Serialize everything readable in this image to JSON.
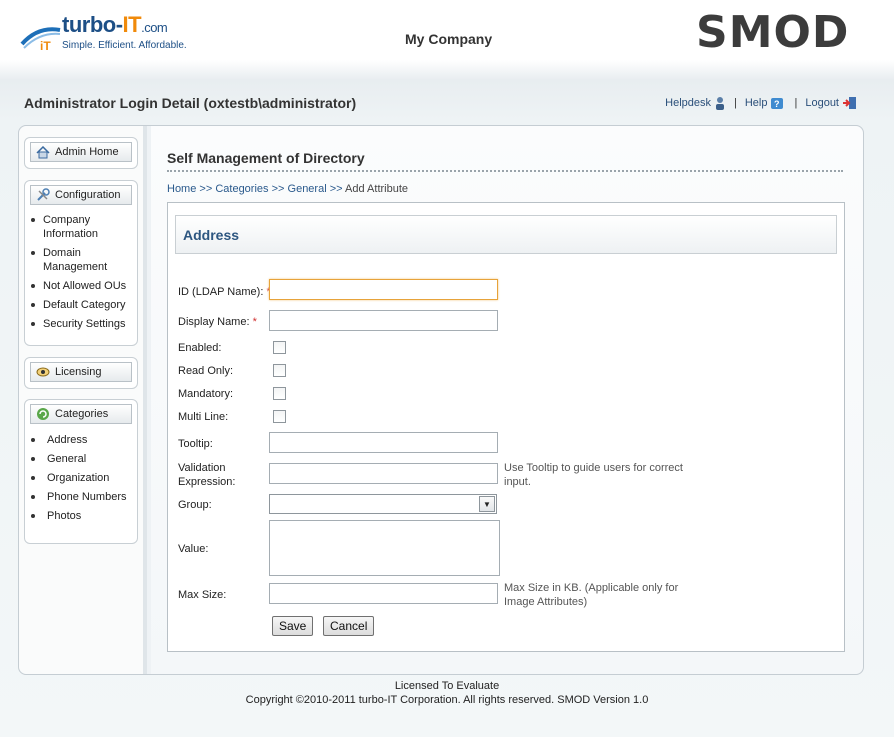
{
  "header": {
    "logo": {
      "name": "turbo-",
      "accent": "IT",
      "suffix": ".com",
      "tagline": "Simple. Efficient. Affordable.",
      "mark": "iT"
    },
    "company": "My Company",
    "brand": "SMOD"
  },
  "titlebar": {
    "title": "Administrator Login Detail (oxtestb\\administrator)",
    "links": {
      "helpdesk": "Helpdesk",
      "help": "Help",
      "logout": "Logout"
    }
  },
  "sidebar": {
    "admin_home": "Admin Home",
    "configuration": {
      "label": "Configuration",
      "items": [
        "Company Information",
        "Domain Management",
        "Not Allowed OUs",
        "Default Category",
        "Security Settings"
      ]
    },
    "licensing": "Licensing",
    "categories": {
      "label": "Categories",
      "items": [
        "Address",
        "General",
        "Organization",
        "Phone Numbers",
        "Photos"
      ]
    }
  },
  "main": {
    "section_title": "Self Management of Directory",
    "breadcrumb": {
      "home": "Home",
      "categories": "Categories",
      "general": "General",
      "current": "Add Attribute",
      "sep": ">>"
    },
    "form": {
      "heading": "Address",
      "fields": {
        "id": {
          "label": "ID (LDAP Name):",
          "value": ""
        },
        "display_name": {
          "label": "Display Name:",
          "value": ""
        },
        "enabled": {
          "label": "Enabled:",
          "checked": false
        },
        "read_only": {
          "label": "Read Only:",
          "checked": false
        },
        "mandatory": {
          "label": "Mandatory:",
          "checked": false
        },
        "multi_line": {
          "label": "Multi Line:",
          "checked": false
        },
        "tooltip": {
          "label": "Tooltip:",
          "value": ""
        },
        "validation": {
          "label": "Validation Expression:",
          "value": "",
          "hint": "Use Tooltip to guide users for correct input."
        },
        "group": {
          "label": "Group:",
          "value": ""
        },
        "value": {
          "label": "Value:",
          "value": ""
        },
        "max_size": {
          "label": "Max Size:",
          "value": "",
          "hint": "Max Size in KB. (Applicable only for Image Attributes)"
        }
      },
      "required_mark": "*",
      "save": "Save",
      "cancel": "Cancel"
    }
  },
  "footer": {
    "license": "Licensed To Evaluate",
    "copyright": "Copyright ©2010-2011 turbo-IT Corporation. All rights reserved. SMOD Version 1.0"
  },
  "colors": {
    "accent": "#2d5680",
    "logo_orange": "#f08a0b",
    "required": "#d03030"
  }
}
